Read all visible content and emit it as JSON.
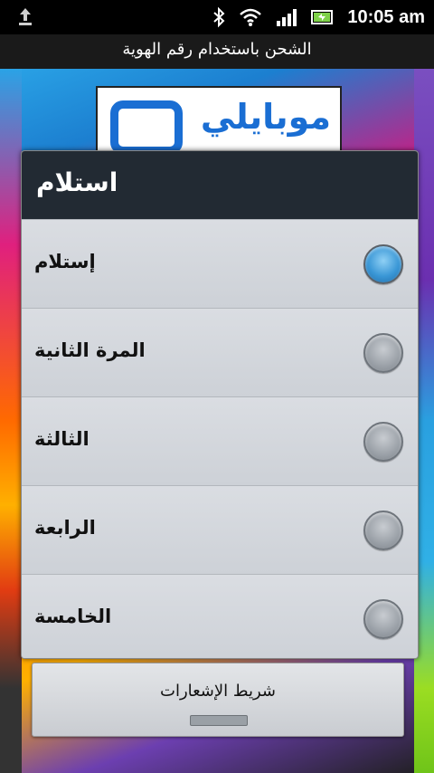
{
  "status_bar": {
    "time": "10:05 am"
  },
  "app": {
    "title": "الشحن باستخدام رقم الهوية"
  },
  "logo": {
    "text": "موبايلي"
  },
  "dialog": {
    "title": "استلام",
    "options": [
      {
        "label": "إستلام",
        "checked": true
      },
      {
        "label": "المرة الثانية",
        "checked": false
      },
      {
        "label": "الثالثة",
        "checked": false
      },
      {
        "label": "الرابعة",
        "checked": false
      },
      {
        "label": "الخامسة",
        "checked": false
      }
    ]
  },
  "notification_bar": {
    "label": "شريط الإشعارات"
  },
  "colors": {
    "accent": "#1a6ed3",
    "radio_selected": "#3a97d6",
    "dialog_header": "#222a33"
  }
}
